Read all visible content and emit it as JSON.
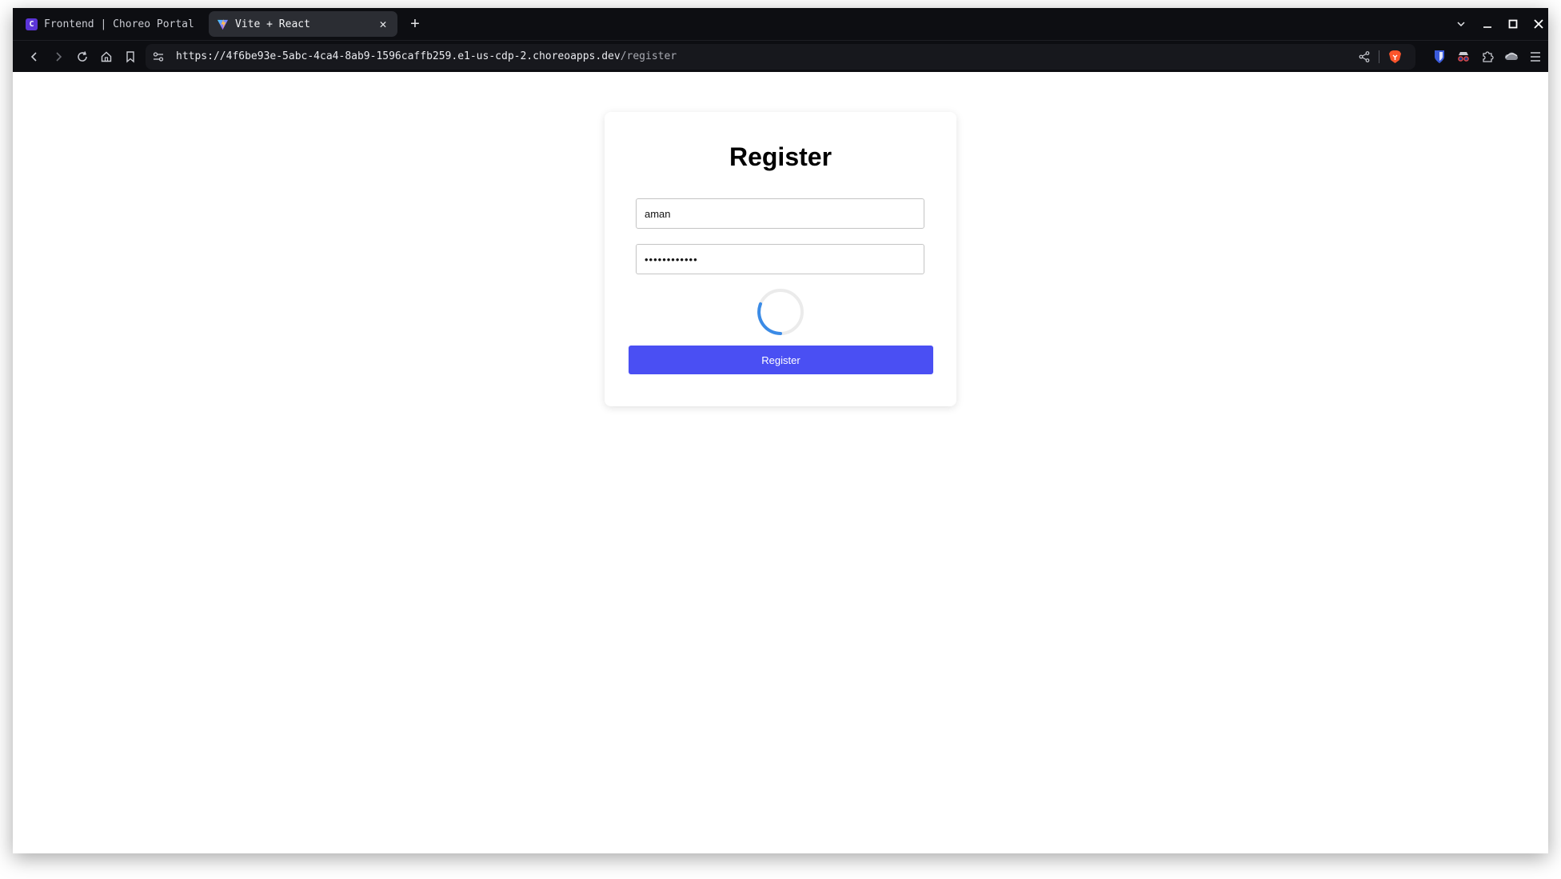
{
  "browser": {
    "tabs": [
      {
        "label": "Frontend | Choreo Portal",
        "favicon": "choreo-logo-icon",
        "active": false
      },
      {
        "label": "Vite + React",
        "favicon": "vite-logo-icon",
        "active": true
      }
    ],
    "url_host": "https://4f6be93e-5abc-4ca4-8ab9-1596caffb259.e1-us-cdp-2.choreoapps.dev",
    "url_path": "/register",
    "toolbar_icons": [
      "back-icon",
      "forward-icon",
      "reload-icon",
      "home-icon",
      "bookmark-icon"
    ],
    "extension_icons": [
      "bitwarden-icon",
      "incognito-glasses-icon",
      "extensions-puzzle-icon",
      "cloud-icon",
      "menu-icon"
    ]
  },
  "page": {
    "title": "Register",
    "username_value": "aman",
    "password_masked": "••••••••••••",
    "submit_label": "Register",
    "loading": true
  },
  "colors": {
    "accent": "#4a4ff3",
    "spinner": "#3b8be6",
    "brave": "#fb542b",
    "choreo": "#5c35d8"
  }
}
